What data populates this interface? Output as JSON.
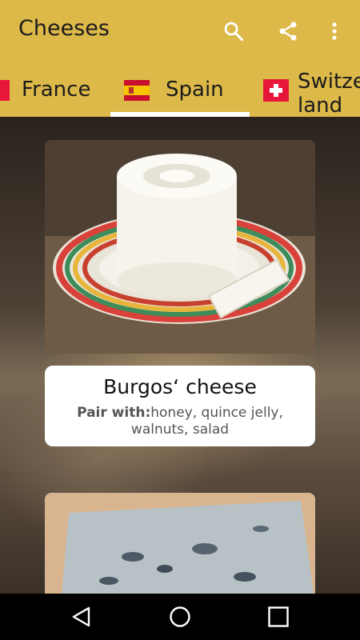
{
  "app": {
    "title": "Cheeses"
  },
  "toolbar": {
    "icons": [
      "search-icon",
      "share-icon",
      "more-vert-icon"
    ]
  },
  "tabs": [
    {
      "label": "France",
      "flag": "flag-france-icon"
    },
    {
      "label": "Spain",
      "flag": "flag-spain-icon",
      "selected": true
    },
    {
      "label": "Switzerland",
      "label_line1": "Switze",
      "label_line2": "land",
      "flag": "flag-switzerland-icon"
    }
  ],
  "cheeses": [
    {
      "name": "Burgos‘ cheese",
      "pair_label": "Pair with:",
      "pair_value": "honey, quince jelly, walnuts, salad"
    }
  ],
  "navbar": {
    "icons": [
      "back-icon",
      "home-icon",
      "recents-icon"
    ]
  },
  "colors": {
    "appbar": "#ddb949",
    "indicator": "#ffffff",
    "navbar": "#000000"
  }
}
